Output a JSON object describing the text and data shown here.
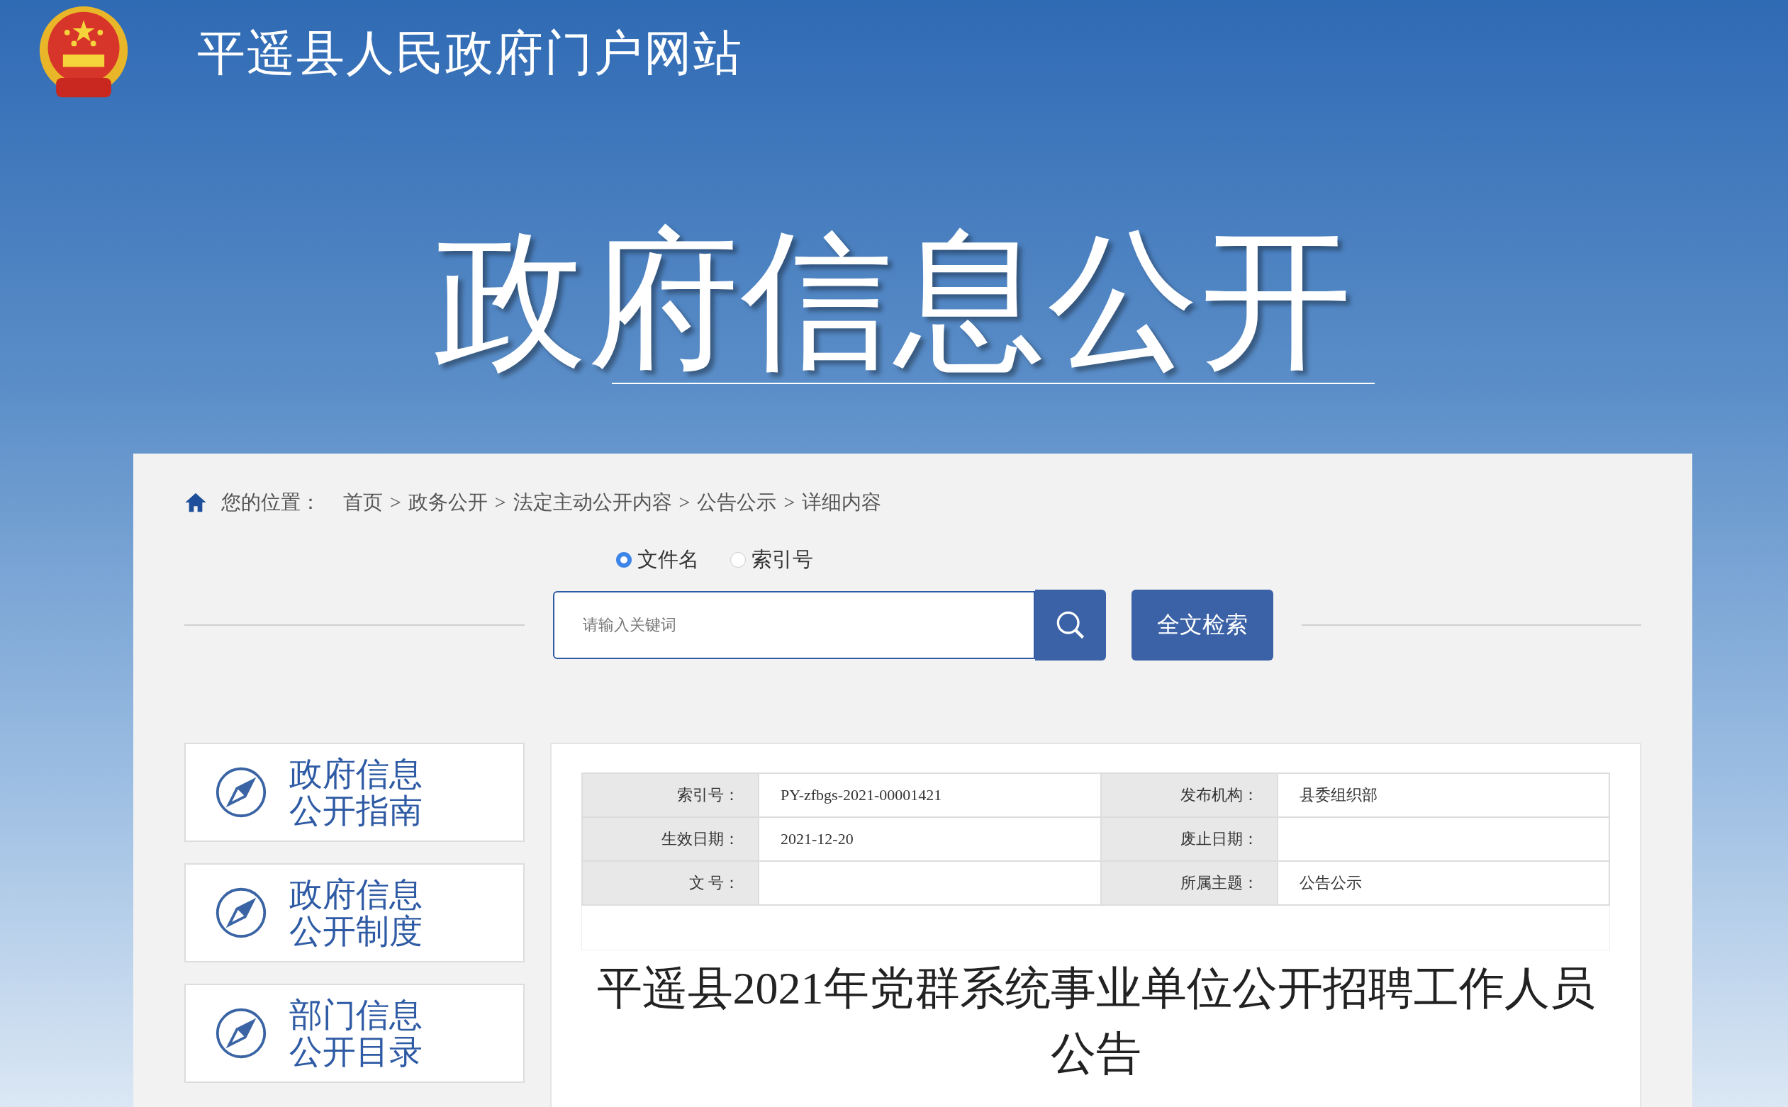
{
  "header": {
    "site_title": "平遥县人民政府门户网站",
    "banner_title": "政府信息公开"
  },
  "breadcrumb": {
    "label": "您的位置：",
    "separator": ">",
    "items": [
      "首页",
      "政务公开",
      "法定主动公开内容",
      "公告公示",
      "详细内容"
    ]
  },
  "search": {
    "options": [
      {
        "label": "文件名",
        "selected": true
      },
      {
        "label": "索引号",
        "selected": false
      }
    ],
    "placeholder": "请输入关键词",
    "button": "全文检索"
  },
  "sidebar": {
    "items": [
      {
        "lines": [
          "政府信息",
          "公开指南"
        ]
      },
      {
        "lines": [
          "政府信息",
          "公开制度"
        ]
      },
      {
        "lines": [
          "部门信息",
          "公开目录"
        ]
      }
    ]
  },
  "info_table": {
    "rows": [
      {
        "label_1": "索引号：",
        "value_1": "PY-zfbgs-2021-00001421",
        "label_2": "发布机构：",
        "value_2": "县委组织部"
      },
      {
        "label_1": "生效日期：",
        "value_1": "2021-12-20",
        "label_2": "废止日期：",
        "value_2": ""
      },
      {
        "label_1": "文 号：",
        "value_1": "",
        "label_2": "所属主题：",
        "value_2": "公告公示"
      }
    ]
  },
  "article": {
    "title": "平遥县2021年党群系统事业单位公开招聘工作人员公告"
  }
}
